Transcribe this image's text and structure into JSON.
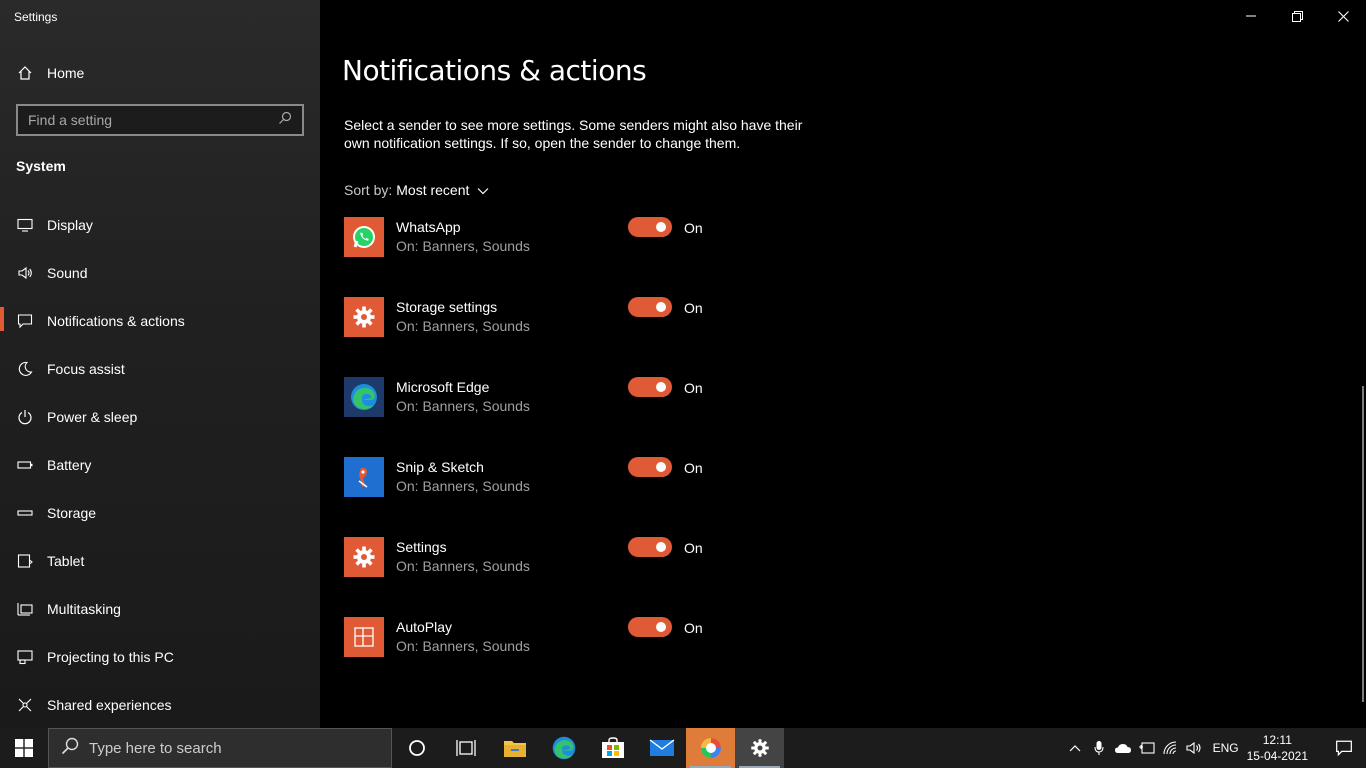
{
  "window": {
    "title": "Settings"
  },
  "sidebar": {
    "home_label": "Home",
    "search_placeholder": "Find a setting",
    "section": "System",
    "items": [
      {
        "label": "Display",
        "icon": "monitor-icon"
      },
      {
        "label": "Sound",
        "icon": "speaker-icon"
      },
      {
        "label": "Notifications & actions",
        "icon": "message-icon",
        "active": true
      },
      {
        "label": "Focus assist",
        "icon": "moon-icon"
      },
      {
        "label": "Power & sleep",
        "icon": "power-icon"
      },
      {
        "label": "Battery",
        "icon": "battery-icon"
      },
      {
        "label": "Storage",
        "icon": "storage-icon"
      },
      {
        "label": "Tablet",
        "icon": "tablet-icon"
      },
      {
        "label": "Multitasking",
        "icon": "multitasking-icon"
      },
      {
        "label": "Projecting to this PC",
        "icon": "projecting-icon"
      },
      {
        "label": "Shared experiences",
        "icon": "shared-icon"
      }
    ]
  },
  "main": {
    "title": "Notifications & actions",
    "description": "Select a sender to see more settings. Some senders might also have their own notification settings. If so, open the sender to change them.",
    "sort_label": "Sort by:",
    "sort_value": "Most recent",
    "senders": [
      {
        "name": "WhatsApp",
        "sub": "On: Banners, Sounds",
        "state": "On",
        "icon": "whatsapp-icon"
      },
      {
        "name": "Storage settings",
        "sub": "On: Banners, Sounds",
        "state": "On",
        "icon": "gear-icon"
      },
      {
        "name": "Microsoft Edge",
        "sub": "On: Banners, Sounds",
        "state": "On",
        "icon": "edge-icon"
      },
      {
        "name": "Snip & Sketch",
        "sub": "On: Banners, Sounds",
        "state": "On",
        "icon": "snip-icon"
      },
      {
        "name": "Settings",
        "sub": "On: Banners, Sounds",
        "state": "On",
        "icon": "gear-icon"
      },
      {
        "name": "AutoPlay",
        "sub": "On: Banners, Sounds",
        "state": "On",
        "icon": "autoplay-icon"
      }
    ]
  },
  "taskbar": {
    "search_placeholder": "Type here to search",
    "language": "ENG",
    "time": "12:11",
    "date": "15-04-2021"
  },
  "colors": {
    "accent": "#e05a35",
    "background": "#000000",
    "sidebar": "#202020"
  }
}
